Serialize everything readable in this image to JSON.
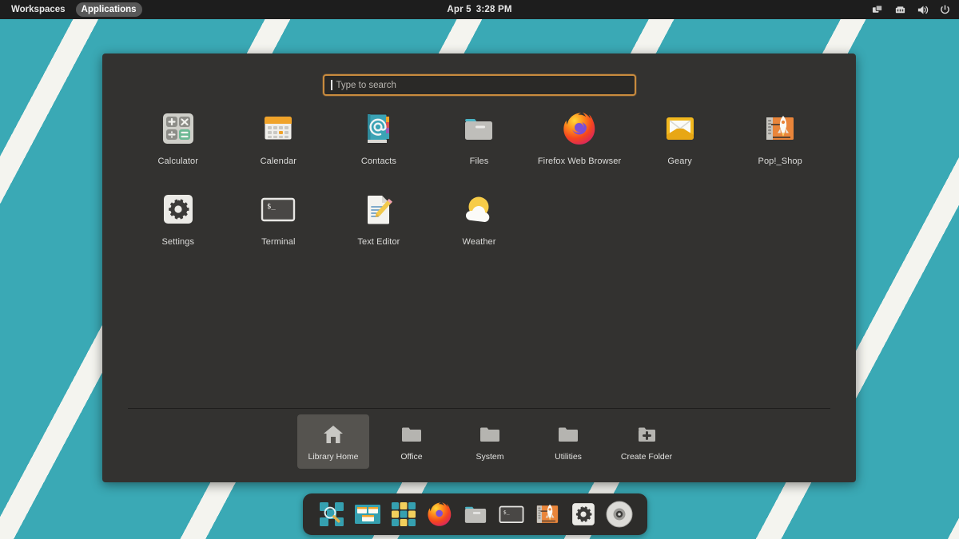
{
  "topbar": {
    "workspaces_label": "Workspaces",
    "applications_label": "Applications",
    "date": "Apr 5",
    "time": "3:28 PM",
    "tray": [
      {
        "name": "display-windows-icon"
      },
      {
        "name": "network-wired-icon"
      },
      {
        "name": "volume-icon"
      },
      {
        "name": "power-icon"
      }
    ]
  },
  "search": {
    "placeholder": "Type to search",
    "value": "",
    "border_color": "#c98b3e"
  },
  "apps": [
    {
      "label": "Calculator",
      "icon": "calculator-icon"
    },
    {
      "label": "Calendar",
      "icon": "calendar-icon"
    },
    {
      "label": "Contacts",
      "icon": "contacts-icon"
    },
    {
      "label": "Files",
      "icon": "files-folder-icon"
    },
    {
      "label": "Firefox Web Browser",
      "icon": "firefox-icon"
    },
    {
      "label": "Geary",
      "icon": "geary-mail-icon"
    },
    {
      "label": "Pop!_Shop",
      "icon": "pop-shop-rocket-icon"
    },
    {
      "label": "Settings",
      "icon": "settings-gear-icon"
    },
    {
      "label": "Terminal",
      "icon": "terminal-icon"
    },
    {
      "label": "Text Editor",
      "icon": "text-editor-icon"
    },
    {
      "label": "Weather",
      "icon": "weather-sun-cloud-icon"
    }
  ],
  "folders": [
    {
      "label": "Library Home",
      "icon": "home-icon",
      "selected": true
    },
    {
      "label": "Office",
      "icon": "folder-icon",
      "selected": false
    },
    {
      "label": "System",
      "icon": "folder-icon",
      "selected": false
    },
    {
      "label": "Utilities",
      "icon": "folder-icon",
      "selected": false
    },
    {
      "label": "Create Folder",
      "icon": "folder-plus-icon",
      "selected": false
    }
  ],
  "dock": [
    {
      "name": "search-launcher-icon"
    },
    {
      "name": "workspaces-icon"
    },
    {
      "name": "app-grid-icon"
    },
    {
      "name": "firefox-icon"
    },
    {
      "name": "files-folder-icon"
    },
    {
      "name": "terminal-icon"
    },
    {
      "name": "pop-shop-rocket-icon"
    },
    {
      "name": "settings-gear-icon"
    },
    {
      "name": "disc-icon"
    }
  ],
  "theme": {
    "wallpaper_color": "#3aa9b5",
    "wallpaper_stripe": "#f4f4ef",
    "panel_bg": "#333230",
    "topbar_bg": "#1d1d1d",
    "accent": "#c98b3e"
  }
}
